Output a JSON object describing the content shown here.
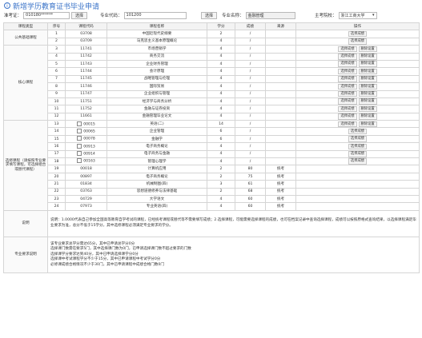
{
  "header": {
    "icon": "info-circle-icon",
    "title": "新增学历教育证书毕业申请"
  },
  "filters": {
    "admission_label": "准考证：",
    "admission_value": "010180******",
    "select_label": "选择",
    "major_code_label": "专业代码：",
    "major_code_value": "101200",
    "query_label": "选择",
    "major_name_label": "专业名称：",
    "major_name_value": "金融管理",
    "school_label": "主考院校：",
    "school_value": "浙江工商大学"
  },
  "columns": [
    "课程类型",
    "序号",
    "课程代码",
    "课程名称",
    "学分",
    "成绩",
    "来源",
    "操作"
  ],
  "groups": {
    "public": "公共基础课程",
    "core": "核心课程",
    "elective": "选修课程（请按照专业要求填写课程，可选择组合或替代课程）"
  },
  "actions": {
    "select": "选择成绩",
    "reset": "删除设置"
  },
  "rows": [
    {
      "group": "public",
      "no": "1",
      "code": "03708",
      "name": "中国近现代史纲要",
      "credit": "2",
      "score": "/",
      "source": "",
      "ops": [
        "select"
      ],
      "check": false
    },
    {
      "group": "public",
      "no": "2",
      "code": "03709",
      "name": "马克思主义基本原理概论",
      "credit": "4",
      "score": "/",
      "source": "",
      "ops": [
        "select"
      ],
      "check": false
    },
    {
      "group": "core",
      "no": "3",
      "code": "11741",
      "name": "市场营销学",
      "credit": "4",
      "score": "/",
      "source": "",
      "ops": [
        "select",
        "reset"
      ],
      "check": false
    },
    {
      "group": "core",
      "no": "4",
      "code": "11742",
      "name": "商务交流",
      "credit": "4",
      "score": "/",
      "source": "",
      "ops": [
        "select",
        "reset"
      ],
      "check": false
    },
    {
      "group": "core",
      "no": "5",
      "code": "11743",
      "name": "企业财务管理",
      "credit": "4",
      "score": "/",
      "source": "",
      "ops": [
        "select",
        "reset"
      ],
      "check": false
    },
    {
      "group": "core",
      "no": "6",
      "code": "11744",
      "name": "会计原理",
      "credit": "4",
      "score": "/",
      "source": "",
      "ops": [
        "select",
        "reset"
      ],
      "check": false
    },
    {
      "group": "core",
      "no": "7",
      "code": "11745",
      "name": "战略管理与伦理",
      "credit": "4",
      "score": "/",
      "source": "",
      "ops": [
        "select",
        "reset"
      ],
      "check": false
    },
    {
      "group": "core",
      "no": "8",
      "code": "11746",
      "name": "国际贸易",
      "credit": "4",
      "score": "/",
      "source": "",
      "ops": [
        "select",
        "reset"
      ],
      "check": false
    },
    {
      "group": "core",
      "no": "9",
      "code": "11747",
      "name": "企业组织与管理",
      "credit": "4",
      "score": "/",
      "source": "",
      "ops": [
        "select",
        "reset"
      ],
      "check": false
    },
    {
      "group": "core",
      "no": "10",
      "code": "11751",
      "name": "经济学与商务分析",
      "credit": "4",
      "score": "/",
      "source": "",
      "ops": [
        "select",
        "reset"
      ],
      "check": false
    },
    {
      "group": "core",
      "no": "11",
      "code": "11752",
      "name": "金融与证券投资",
      "credit": "4",
      "score": "/",
      "source": "",
      "ops": [
        "select",
        "reset"
      ],
      "check": false
    },
    {
      "group": "core",
      "no": "12",
      "code": "11661",
      "name": "金融管理毕业论文",
      "credit": "4",
      "score": "/",
      "source": "",
      "ops": [
        "select",
        "reset"
      ],
      "check": false
    },
    {
      "group": "elective",
      "no": "13",
      "code": "00015",
      "name": "英语(二)",
      "credit": "14",
      "score": "/",
      "source": "",
      "ops": [
        "select",
        "reset"
      ],
      "check": true
    },
    {
      "group": "elective",
      "no": "14",
      "code": "00065",
      "name": "企业管理",
      "credit": "6",
      "score": "/",
      "source": "",
      "ops": [
        "select"
      ],
      "check": true
    },
    {
      "group": "elective",
      "no": "15",
      "code": "00078",
      "name": "金融学",
      "credit": "6",
      "score": "/",
      "source": "",
      "ops": [
        "select"
      ],
      "check": true
    },
    {
      "group": "elective",
      "no": "16",
      "code": "00913",
      "name": "电子商务概论",
      "credit": "4",
      "score": "/",
      "source": "",
      "ops": [
        "select"
      ],
      "check": true
    },
    {
      "group": "elective",
      "no": "17",
      "code": "00914",
      "name": "电子商务与金融",
      "credit": "4",
      "score": "/",
      "source": "",
      "ops": [
        "select"
      ],
      "check": true
    },
    {
      "group": "elective",
      "no": "18",
      "code": "00163",
      "name": "管理心理学",
      "credit": "4",
      "score": "/",
      "source": "",
      "ops": [
        "select"
      ],
      "check": true
    },
    {
      "group": "elective",
      "no": "19",
      "code": "00018",
      "name": "计算机应用",
      "credit": "2",
      "score": "80",
      "source": "统考",
      "ops": [],
      "check": false
    },
    {
      "group": "elective",
      "no": "20",
      "code": "00897",
      "name": "电子商务概论",
      "credit": "2",
      "score": "75",
      "source": "统考",
      "ops": [],
      "check": false
    },
    {
      "group": "elective",
      "no": "21",
      "code": "01834",
      "name": "机械制图(四)",
      "credit": "3",
      "score": "61",
      "source": "统考",
      "ops": [],
      "check": false
    },
    {
      "group": "elective",
      "no": "22",
      "code": "03763",
      "name": "思想道德修养与法律基础",
      "credit": "2",
      "score": "68",
      "source": "统考",
      "ops": [],
      "check": false
    },
    {
      "group": "elective",
      "no": "23",
      "code": "04729",
      "name": "大学语文",
      "credit": "4",
      "score": "60",
      "source": "统考",
      "ops": [],
      "check": false
    },
    {
      "group": "elective",
      "no": "24",
      "code": "07973",
      "name": "专业英语(四)",
      "credit": "4",
      "score": "60",
      "source": "统考",
      "ops": [],
      "check": false
    }
  ],
  "notes": {
    "explain_label": "说明",
    "explain_text": "说明：1.0000代表自己参加全国高等教育自学考试的课程，已经统考课程或替代等不需要填写成绩；2.选择课程，可能需要选择课程的成绩，也可在档案记录中查询选择课程，成绩可以按照原格式查询结果，以选择课程满足毕业要求为准，总分不低于15学分，其中选修课程必须满足专业要求的学分。",
    "req_label": "专业要求说明",
    "req_text": "该专业要求总学分需达65分，其中已申请总学分0分\n选择课门数需在要求5门，其中选择课门数为0门，已申请选择课门数不超过要求的门数\n选择课学分要求达到40分，其中已申请选择课学分0分\n选择课中考试课程学分不少于15分，其中已申请课程中考试学分0分\n必修课成绩合格情况不少于30门，其中已申请课程中成绩合格门数0门"
  }
}
